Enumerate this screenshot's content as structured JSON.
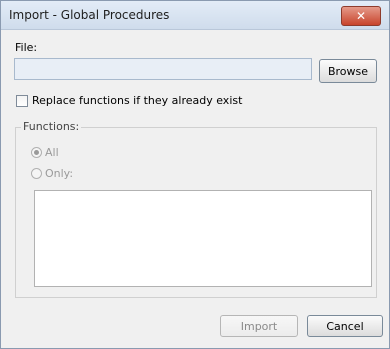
{
  "window": {
    "title": "Import - Global Procedures",
    "close_symbol": "✕"
  },
  "file": {
    "label": "File:",
    "value": "",
    "browse_label": "Browse"
  },
  "replace": {
    "label": "Replace functions if they already exist",
    "checked": false
  },
  "functions": {
    "group_label": "Functions:",
    "option_all": "All",
    "option_only": "Only:",
    "selected": "All",
    "list_items": []
  },
  "footer": {
    "import_label": "Import",
    "cancel_label": "Cancel"
  }
}
